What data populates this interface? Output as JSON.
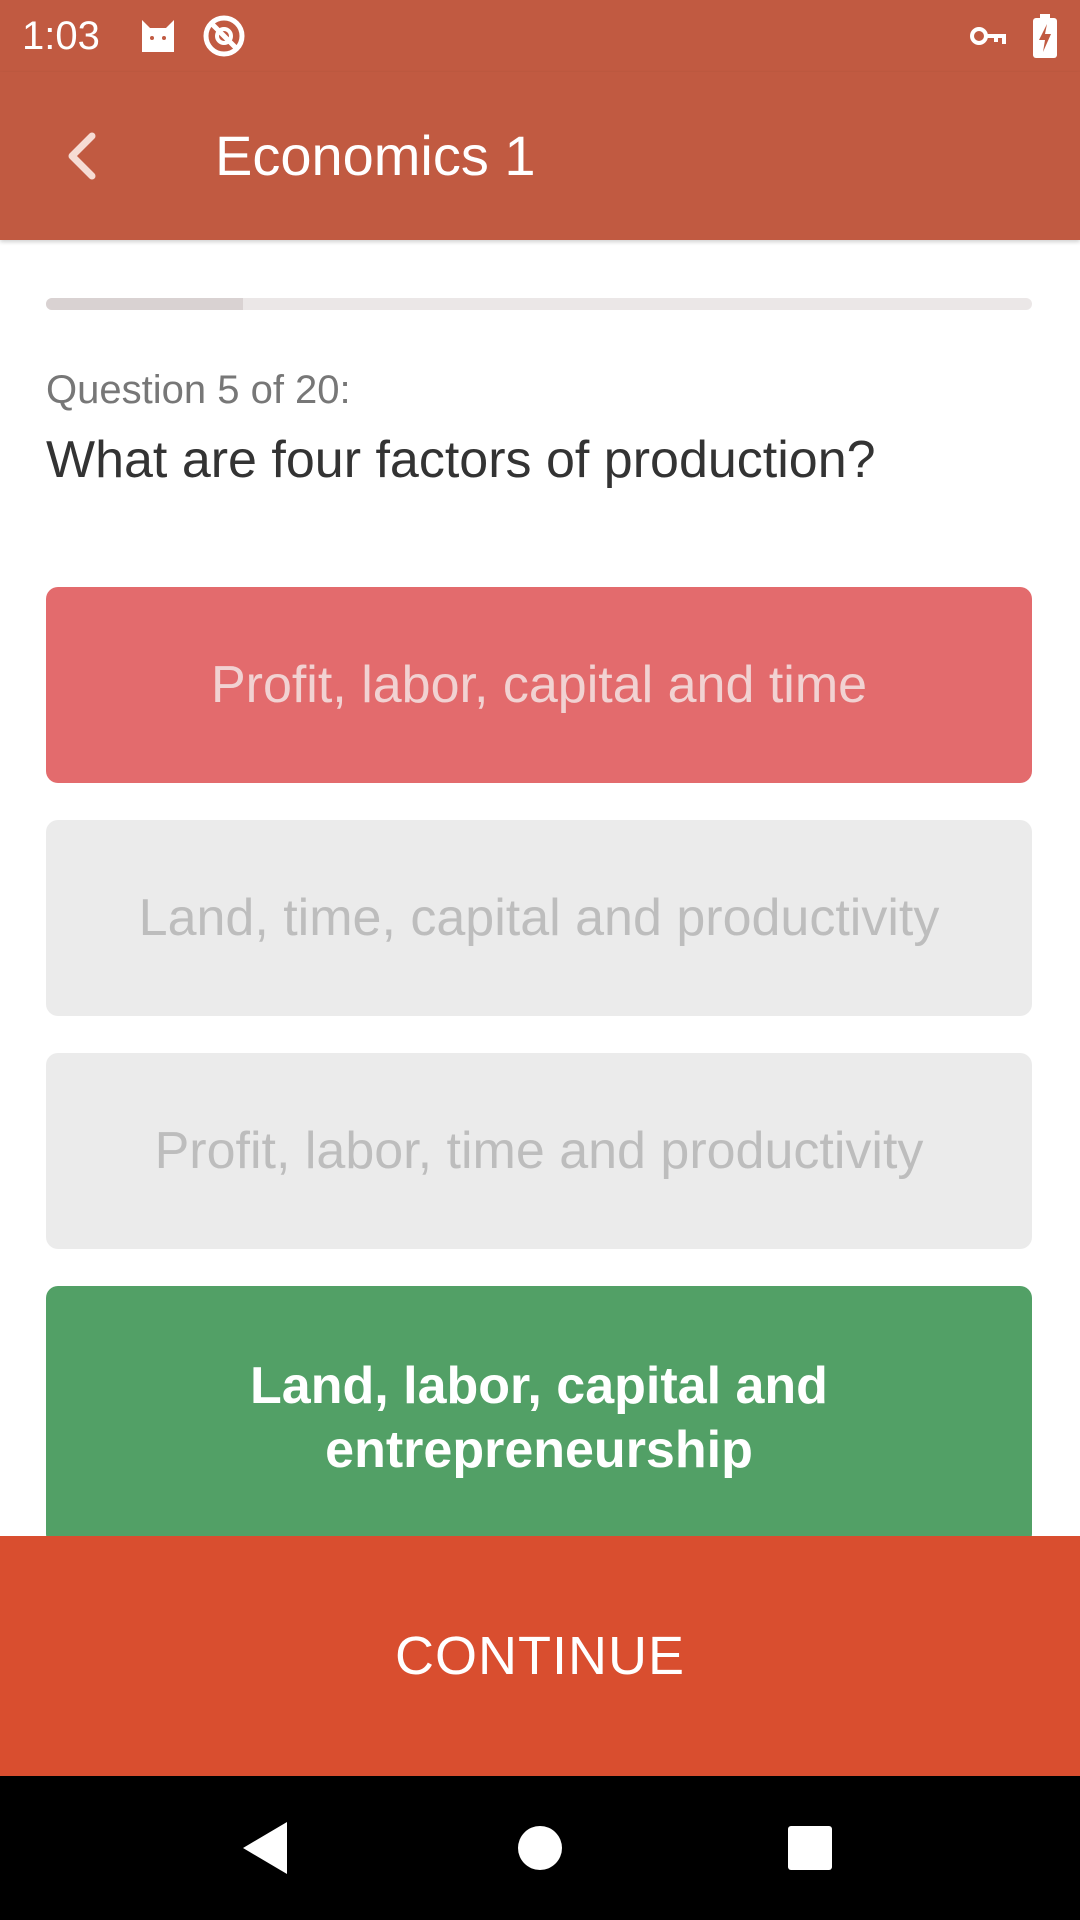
{
  "status_bar": {
    "time": "1:03",
    "icons": [
      "cat-notification-icon",
      "no-disturb-icon",
      "vpn-key-icon",
      "battery-charging-icon"
    ]
  },
  "app_bar": {
    "title": "Economics 1",
    "back_icon": "chevron-left-icon"
  },
  "quiz": {
    "progress_fraction": 0.2,
    "question_counter": "Question 5 of 20:",
    "question": "What are four factors of production?",
    "answers": [
      {
        "label": "Profit, labor, capital and time",
        "state": "wrong"
      },
      {
        "label": "Land, time, capital and productivity",
        "state": "neutral"
      },
      {
        "label": "Profit, labor, time and productivity",
        "state": "neutral"
      },
      {
        "label": "Land, labor, capital and entrepreneurship",
        "state": "correct"
      }
    ]
  },
  "continue_button": {
    "label": "CONTINUE"
  },
  "nav_bar": {
    "icons": [
      "back-triangle-icon",
      "home-circle-icon",
      "recents-square-icon"
    ]
  },
  "colors": {
    "primary": "#c15a41",
    "continue": "#d94e2f",
    "wrong": "#e36b6d",
    "correct": "#52a066",
    "neutral": "#ebebeb"
  }
}
